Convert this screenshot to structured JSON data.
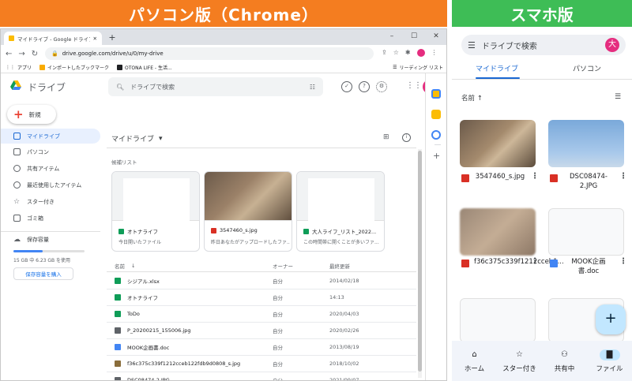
{
  "banners": {
    "pc": "パソコン版（Chrome）",
    "sp": "スマホ版"
  },
  "browser": {
    "tab_title": "マイドライブ - Google ドライブ",
    "url": "drive.google.com/drive/u/0/my-drive",
    "bookmarks": [
      "アプリ",
      "インポートしたブックマーク",
      "OTONA LIFE - 生活...",
      "リーディング リスト"
    ]
  },
  "drive": {
    "logo_text": "ドライブ",
    "search_placeholder": "ドライブで検索",
    "avatar_initial": "大",
    "new_label": "新規",
    "nav": [
      {
        "label": "マイドライブ",
        "icon": "my-drive-icon"
      },
      {
        "label": "パソコン",
        "icon": "computer-icon"
      },
      {
        "label": "共有アイテム",
        "icon": "people-icon"
      },
      {
        "label": "最近使用したアイテム",
        "icon": "clock-icon"
      },
      {
        "label": "スター付き",
        "icon": "star-icon"
      },
      {
        "label": "ゴミ箱",
        "icon": "trash-icon"
      }
    ],
    "storage": {
      "title": "保存容量",
      "used_text": "15 GB 中 6.23 GB を使用",
      "fraction": 0.415,
      "buy_label": "保存容量を購入"
    },
    "main_title": "マイドライブ",
    "suggested_label": "候補リスト",
    "cards": [
      {
        "name": "オトナライフ",
        "sub": "今日開いたファイル",
        "icon_color": "#0f9d58"
      },
      {
        "name": "3547460_s.jpg",
        "sub": "昨日あなたがアップロードしたファ...",
        "icon_color": "#d93025"
      },
      {
        "name": "大人ライフ_リスト_2022...",
        "sub": "この時間帯に開くことが多いファ...",
        "icon_color": "#0f9d58"
      }
    ],
    "list_headers": {
      "name": "名前",
      "owner": "オーナー",
      "date": "最終更新"
    },
    "files": [
      {
        "name": "シジアル.xlsx",
        "owner": "自分",
        "date": "2014/02/18",
        "icon_color": "#0f9d58"
      },
      {
        "name": "オトナライフ",
        "owner": "自分",
        "date": "14:13",
        "icon_color": "#0f9d58"
      },
      {
        "name": "ToDo",
        "owner": "自分",
        "date": "2020/04/03",
        "icon_color": "#0f9d58"
      },
      {
        "name": "P_20200215_155006.jpg",
        "owner": "自分",
        "date": "2020/02/26",
        "icon_color": "#5f6368"
      },
      {
        "name": "MOOK企画書.doc",
        "owner": "自分",
        "date": "2013/08/19",
        "icon_color": "#4285f4"
      },
      {
        "name": "f36c375c339f1212cceb122fdb9d0808_s.jpg",
        "owner": "自分",
        "date": "2018/10/02",
        "icon_color": "#8a6d3b"
      },
      {
        "name": "DSC08474-2.JPG",
        "owner": "自分",
        "date": "2021/09/07",
        "icon_color": "#5f6368"
      }
    ]
  },
  "phone": {
    "search_placeholder": "ドライブで検索",
    "avatar_initial": "大",
    "tabs": [
      "マイドライブ",
      "パソコン"
    ],
    "sort_label": "名前 ↑",
    "files": [
      {
        "name": "3547460_s.jpg",
        "icon_color": "#d93025"
      },
      {
        "name": "DSC08474-2.JPG",
        "icon_color": "#d93025"
      },
      {
        "name": "f36c375c339f1212cceb1...",
        "icon_color": "#d93025"
      },
      {
        "name": "MOOK企画書.doc",
        "icon_color": "#4285f4"
      }
    ],
    "fab_label": "+",
    "nav": [
      {
        "label": "ホーム",
        "icon": "home-icon"
      },
      {
        "label": "スター付き",
        "icon": "star-icon"
      },
      {
        "label": "共有中",
        "icon": "people-icon"
      },
      {
        "label": "ファイル",
        "icon": "folder-icon"
      }
    ]
  }
}
